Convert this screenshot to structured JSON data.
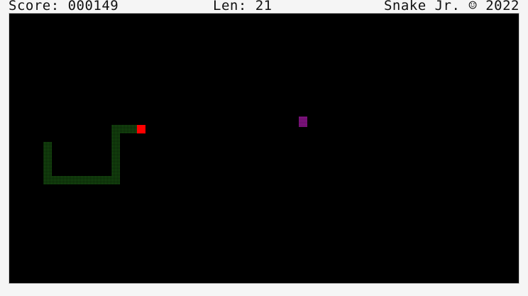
{
  "hud": {
    "score_text": "Score: 000149",
    "length_text": "Len: 21",
    "title_text": "Snake Jr. ☺ 2022"
  },
  "game": {
    "score": 149,
    "length": 21,
    "year": 2022,
    "colors": {
      "background": "#000000",
      "snake_body": "#1a5a12",
      "snake_head": "#ff0000",
      "food": "#8a148a",
      "hud_text": "#111111"
    },
    "snake": {
      "head": [
        15,
        13
      ],
      "body": [
        [
          14,
          13
        ],
        [
          13,
          13
        ],
        [
          12,
          13
        ],
        [
          12,
          14
        ],
        [
          12,
          15
        ],
        [
          12,
          16
        ],
        [
          12,
          17
        ],
        [
          12,
          18
        ],
        [
          12,
          19
        ],
        [
          11,
          19
        ],
        [
          10,
          19
        ],
        [
          9,
          19
        ],
        [
          8,
          19
        ],
        [
          7,
          19
        ],
        [
          6,
          19
        ],
        [
          5,
          19
        ],
        [
          4,
          19
        ],
        [
          4,
          18
        ],
        [
          4,
          17
        ],
        [
          4,
          16
        ],
        [
          4,
          15
        ]
      ]
    },
    "food": [
      34,
      12
    ]
  }
}
